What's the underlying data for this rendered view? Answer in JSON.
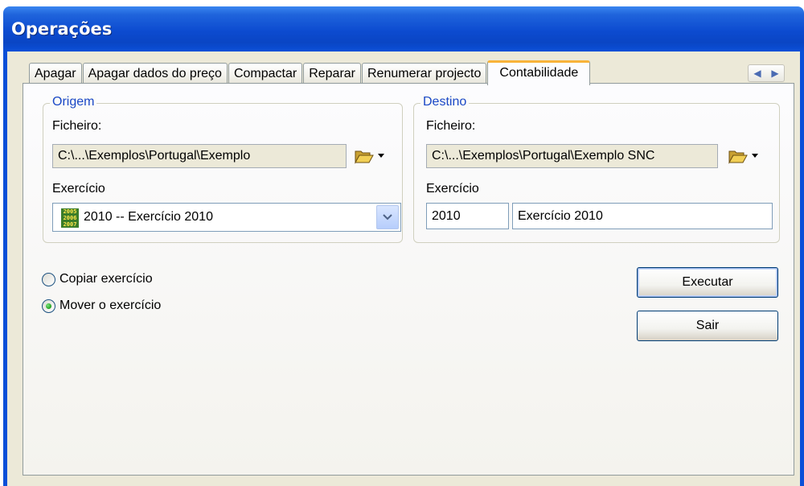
{
  "window": {
    "title": "Operações"
  },
  "tabs": [
    {
      "label": "Apagar"
    },
    {
      "label": "Apagar dados do preço"
    },
    {
      "label": "Compactar"
    },
    {
      "label": "Reparar"
    },
    {
      "label": "Renumerar projecto"
    },
    {
      "label": "Contabilidade",
      "active": true
    }
  ],
  "origem": {
    "caption": "Origem",
    "file_label": "Ficheiro:",
    "file_value": "C:\\...\\Exemplos\\Portugal\\Exemplo",
    "year_label": "Exercício",
    "year_selected": "2010 -- Exercício 2010",
    "year_icon_text": "2005 2006 2007"
  },
  "destino": {
    "caption": "Destino",
    "file_label": "Ficheiro:",
    "file_value": "C:\\...\\Exemplos\\Portugal\\Exemplo SNC",
    "year_label": "Exercício",
    "year_code": "2010",
    "year_name": "Exercício 2010"
  },
  "options": {
    "copy_label": "Copiar exercício",
    "move_label": "Mover o exercício",
    "selected": "move"
  },
  "buttons": {
    "execute_label": "Executar",
    "exit_label": "Sair"
  },
  "colors": {
    "titlebar": "#0b4fd8",
    "active_tab_accent": "#f8b33a",
    "group_caption": "#1a48c6"
  }
}
